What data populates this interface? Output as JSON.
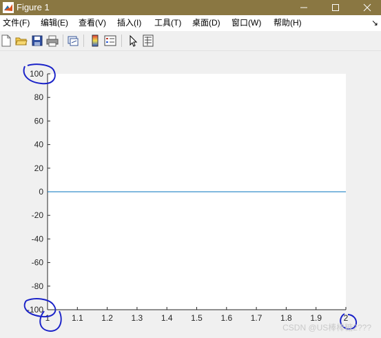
{
  "window": {
    "title": "Figure 1"
  },
  "menubar": {
    "items": [
      {
        "label": "文件(F)"
      },
      {
        "label": "编辑(E)"
      },
      {
        "label": "查看(V)"
      },
      {
        "label": "插入(I)"
      },
      {
        "label": "工具(T)"
      },
      {
        "label": "桌面(D)"
      },
      {
        "label": "窗口(W)"
      },
      {
        "label": "帮助(H)"
      }
    ]
  },
  "toolbar": {
    "icons": [
      "new-figure-icon",
      "open-file-icon",
      "save-icon",
      "print-icon",
      "link-plot-icon",
      "insert-colorbar-icon",
      "insert-legend-icon",
      "edit-plot-pointer-icon",
      "property-inspector-icon"
    ]
  },
  "chart_data": {
    "type": "line",
    "x": [
      1,
      2
    ],
    "series": [
      {
        "values": [
          0,
          0
        ],
        "color": "#0072bd"
      }
    ],
    "xlim": [
      1,
      2
    ],
    "ylim": [
      -100,
      100
    ],
    "xticks": [
      "1",
      "1.1",
      "1.2",
      "1.3",
      "1.4",
      "1.5",
      "1.6",
      "1.7",
      "1.8",
      "1.9",
      "2"
    ],
    "yticks": [
      "100",
      "80",
      "60",
      "40",
      "20",
      "0",
      "-20",
      "-40",
      "-60",
      "-80",
      "-100"
    ],
    "title": "",
    "xlabel": "",
    "ylabel": "",
    "grid": false,
    "annotations": [
      "hand-drawn blue circles around 100, -100, 1 and 2 tick labels"
    ]
  },
  "watermark": "CSDN @US棒棒糖2???"
}
